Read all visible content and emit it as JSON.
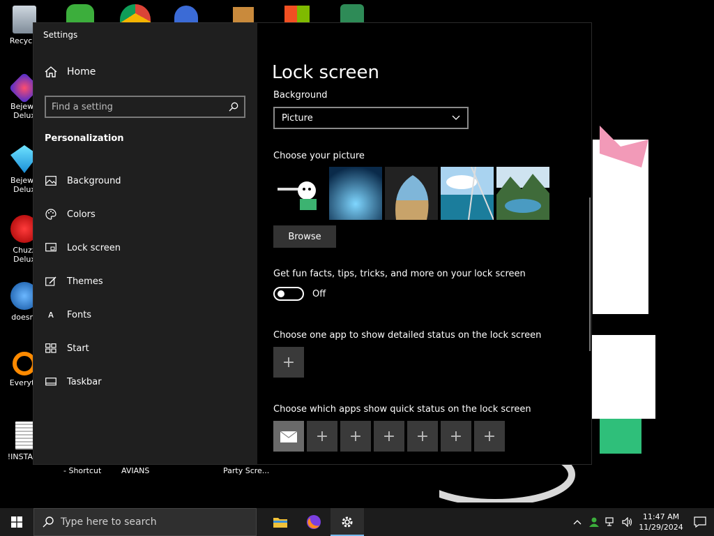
{
  "desktop": {
    "icons": [
      {
        "label": "Recycle",
        "icon": "recycle-bin-icon"
      },
      {
        "label": "Bejewe\nDelux",
        "icon": "bejeweled-icon"
      },
      {
        "label": "Bejewe\nDelux",
        "icon": "bejeweled-icon"
      },
      {
        "label": "Chuzz\nDelux",
        "icon": "chuzzle-icon"
      },
      {
        "label": "doesnt",
        "icon": "app-icon"
      },
      {
        "label": "Everyth",
        "icon": "everything-search-icon"
      },
      {
        "label": "!INSTALL",
        "icon": "document-icon"
      }
    ],
    "below_labels": [
      "- Shortcut",
      "AVIANS",
      "Party Scre..."
    ]
  },
  "window": {
    "title": "Settings",
    "controls": {
      "minimize": "—",
      "maximize": "☐",
      "close": "✕"
    }
  },
  "sidebar": {
    "home_label": "Home",
    "search_placeholder": "Find a setting",
    "section_title": "Personalization",
    "items": [
      {
        "label": "Background",
        "icon": "picture-icon"
      },
      {
        "label": "Colors",
        "icon": "palette-icon"
      },
      {
        "label": "Lock screen",
        "icon": "lock-screen-icon"
      },
      {
        "label": "Themes",
        "icon": "themes-icon"
      },
      {
        "label": "Fonts",
        "icon": "fonts-icon"
      },
      {
        "label": "Start",
        "icon": "start-icon"
      },
      {
        "label": "Taskbar",
        "icon": "taskbar-icon"
      }
    ]
  },
  "content": {
    "title": "Lock screen",
    "background_label": "Background",
    "background_value": "Picture",
    "choose_picture_label": "Choose your picture",
    "browse_label": "Browse",
    "fun_facts_label": "Get fun facts, tips, tricks, and more on your lock screen",
    "fun_facts_state": "Off",
    "detailed_status_label": "Choose one app to show detailed status on the lock screen",
    "quick_status_label": "Choose which apps show quick status on the lock screen",
    "add_symbol": "+"
  },
  "taskbar": {
    "search_placeholder": "Type here to search",
    "time": "11:47 AM",
    "date": "11/29/2024"
  },
  "colors": {
    "accent": "#76b9ed",
    "sidebar_bg": "#1f1f1f",
    "content_bg": "#000000",
    "taskbar_bg": "#1c1c1c"
  }
}
